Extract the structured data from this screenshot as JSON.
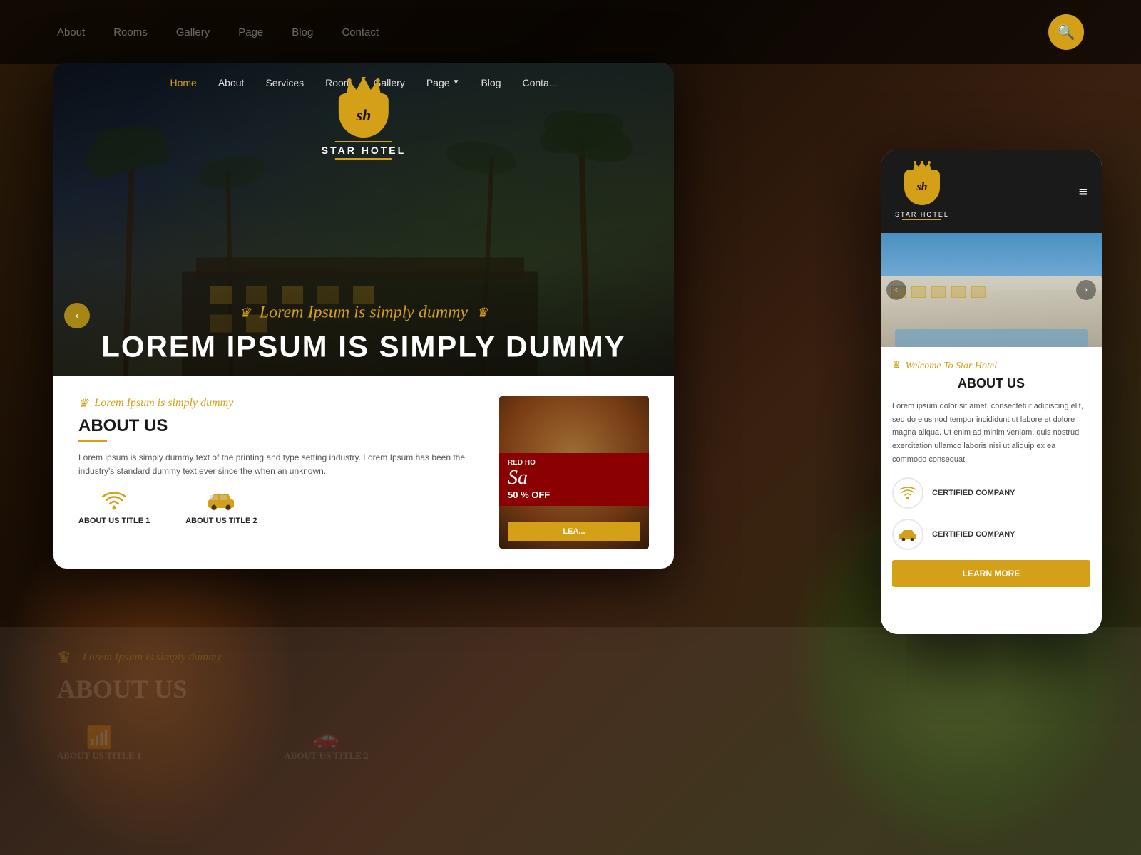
{
  "site": {
    "name": "STAR HOTEL",
    "logo_initials": "sh",
    "tagline": "Lorem Ipsum is simply dummy"
  },
  "bg_nav": {
    "links": [
      "About",
      "Rooms",
      "Gallery",
      "Page",
      "Blog",
      "Contact"
    ]
  },
  "desktop": {
    "nav": {
      "home": "Home",
      "about": "About",
      "services": "Services",
      "room": "Room",
      "gallery": "Gallery",
      "page": "Page",
      "blog": "Blog",
      "contact": "Conta..."
    },
    "hero": {
      "script_text": "Lorem Ipsum is simply dummy",
      "main_title": "LOREM IPSUM IS SIMPLY DUMMY"
    },
    "about": {
      "script_label": "Lorem Ipsum is simply dummy",
      "heading": "ABOUT US",
      "body": "Lorem ipsum is simply dummy text of the printing and type setting industry. Lorem Ipsum has been the industry's standard dummy text ever since the when an unknown.",
      "icon1_label": "ABOUT US TITLE 1",
      "icon2_label": "ABOUT US TITLE 2",
      "sale_store": "RED HO",
      "sale_script": "Sa",
      "sale_discount": "50 % OFF",
      "learn_btn": "LEA..."
    }
  },
  "mobile": {
    "header": {
      "hotel_name": "STAR HOTEL"
    },
    "about": {
      "welcome_text": "Welcome To Star Hotel",
      "heading": "ABOUT US",
      "body": "Lorem ipsum dolor sit amet, consectetur adipiscing elit, sed do eiusmod tempor incididunt ut labore et dolore magna aliqua. Ut enim ad minim veniam, quis nostrud exercitation ullamco laboris nisi ut aliquip ex ea commodo consequat.",
      "cert1_label": "CERTIFIED COMPANY",
      "cert2_label": "CERTIFIED COMPANY",
      "learn_btn": "LEARN MORE"
    }
  },
  "bg_bottom": {
    "about_title": "ABO",
    "icon1_label": "ABOUT US TITLE 1",
    "icon2_label": "ABOUT US TITLE 2"
  }
}
